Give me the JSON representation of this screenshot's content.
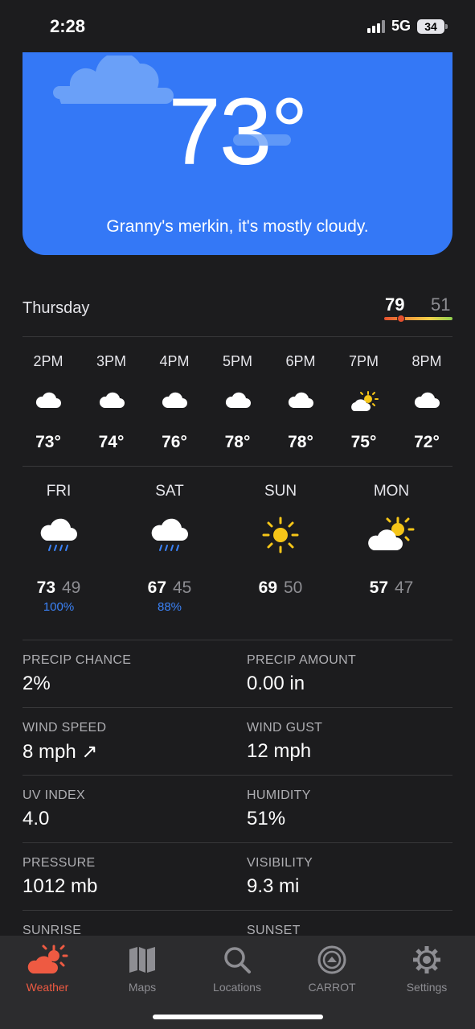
{
  "status_bar": {
    "time": "2:28",
    "network": "5G",
    "battery": "34"
  },
  "hero": {
    "temperature": "73°",
    "caption": "Granny's merkin, it's mostly cloudy."
  },
  "today": {
    "day": "Thursday",
    "high": "79",
    "low": "51"
  },
  "hourly": [
    {
      "time": "2PM",
      "icon": "cloud-icon",
      "temp": "73°"
    },
    {
      "time": "3PM",
      "icon": "cloud-icon",
      "temp": "74°"
    },
    {
      "time": "4PM",
      "icon": "cloud-icon",
      "temp": "76°"
    },
    {
      "time": "5PM",
      "icon": "cloud-icon",
      "temp": "78°"
    },
    {
      "time": "6PM",
      "icon": "cloud-icon",
      "temp": "78°"
    },
    {
      "time": "7PM",
      "icon": "partly-sunny-icon",
      "temp": "75°"
    },
    {
      "time": "8PM",
      "icon": "cloud-icon",
      "temp": "72°"
    }
  ],
  "daily": [
    {
      "day": "FRI",
      "icon": "rain-cloud-icon",
      "high": "73",
      "low": "49",
      "precip": "100%"
    },
    {
      "day": "SAT",
      "icon": "rain-cloud-icon",
      "high": "67",
      "low": "45",
      "precip": "88%"
    },
    {
      "day": "SUN",
      "icon": "sun-icon",
      "high": "69",
      "low": "50",
      "precip": ""
    },
    {
      "day": "MON",
      "icon": "partly-sunny-icon",
      "high": "57",
      "low": "47",
      "precip": ""
    }
  ],
  "details": [
    {
      "left_label": "PRECIP CHANCE",
      "left_value": "2%",
      "right_label": "PRECIP AMOUNT",
      "right_value": "0.00 in"
    },
    {
      "left_label": "WIND SPEED",
      "left_value": "8 mph ↗",
      "right_label": "WIND GUST",
      "right_value": "12 mph"
    },
    {
      "left_label": "UV INDEX",
      "left_value": "4.0",
      "right_label": "HUMIDITY",
      "right_value": "51%"
    },
    {
      "left_label": "PRESSURE",
      "left_value": "1012 mb",
      "right_label": "VISIBILITY",
      "right_value": "9.3 mi"
    },
    {
      "left_label": "SUNRISE",
      "left_value": "",
      "right_label": "SUNSET",
      "right_value": ""
    }
  ],
  "tabs": [
    {
      "label": "Weather",
      "icon": "weather-icon",
      "active": true
    },
    {
      "label": "Maps",
      "icon": "map-icon",
      "active": false
    },
    {
      "label": "Locations",
      "icon": "search-icon",
      "active": false
    },
    {
      "label": "CARROT",
      "icon": "carrot-icon",
      "active": false
    },
    {
      "label": "Settings",
      "icon": "gear-icon",
      "active": false
    }
  ],
  "colors": {
    "hero_blue": "#3478f6",
    "accent_red": "#ee5a42",
    "precip_blue": "#3b82f6",
    "sun_yellow": "#f5c518",
    "background": "#1c1c1e"
  }
}
